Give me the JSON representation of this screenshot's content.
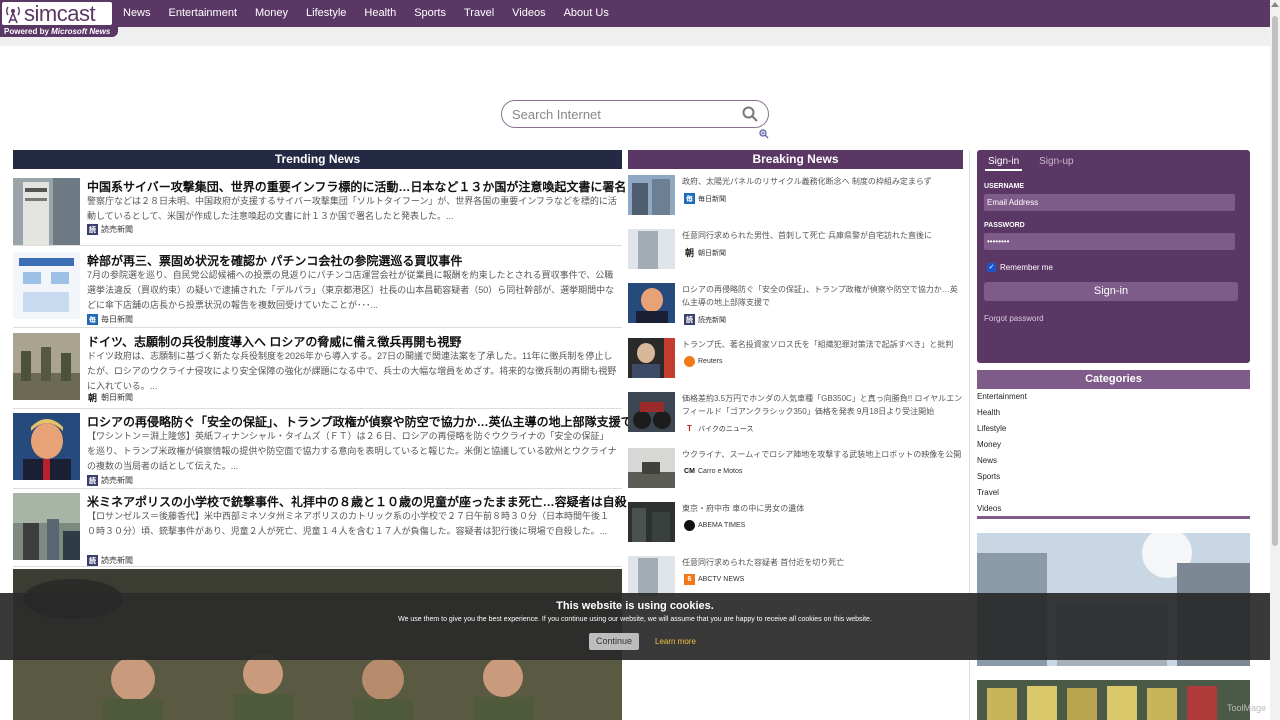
{
  "brand": {
    "name": "simcast",
    "powered_prefix": "Powered by",
    "powered_brand": "Microsoft News",
    "color": "#5b3766"
  },
  "nav": {
    "items": [
      "News",
      "Entertainment",
      "Money",
      "Lifestyle",
      "Health",
      "Sports",
      "Travel",
      "Videos",
      "About Us"
    ]
  },
  "search": {
    "placeholder": "Search Internet",
    "icon": "magnifier-icon"
  },
  "trending": {
    "heading": "Trending News",
    "items": [
      {
        "title": "中国系サイバー攻撃集団、世界の重要インフラ標的に活動…日本など１３か国が注意喚起文書に署名",
        "desc": "警察庁などは２８日未明、中国政府が支援するサイバー攻撃集団「ソルトタイフーン」が、世界各国の重要インフラなどを標的に活動しているとして、米国が作成した注意喚起の文書に計１３か国で署名したと発表した。...",
        "source": "読売新聞"
      },
      {
        "title": "幹部が再三、票固め状況を確認か パチンコ会社の参院選巡る買収事件",
        "desc": "7月の参院選を巡り、自民党公認候補への投票の見返りにパチンコ店運営会社が従業員に報酬を約束したとされる買収事件で、公職選挙法違反（買収約束）の疑いで逮捕された「デルパラ」（東京都港区）社長の山本昌範容疑者（50）ら同社幹部が、選挙期間中などに傘下店舗の店長から投票状況の報告を複数回受けていたことが･･･...",
        "source": "毎日新聞"
      },
      {
        "title": "ドイツ、志願制の兵役制度導入へ ロシアの脅威に備え徴兵再開も視野",
        "desc": "ドイツ政府は、志願制に基づく新たな兵役制度を2026年から導入する。27日の閣議で関連法案を了承した。11年に徴兵制を停止したが、ロシアのウクライナ侵攻により安全保障の強化が課題になる中で、兵士の大幅な増員をめざす。将来的な徴兵制の再開も視野に入れている。...",
        "source": "朝日新聞"
      },
      {
        "title": "ロシアの再侵略防ぐ「安全の保証」、トランプ政権が偵察や防空で協力か…英仏主導の地上部隊支援で",
        "desc": "【ワシントン＝淵上隆悠】英紙フィナンシャル・タイムズ（ＦＴ）は２６日、ロシアの再侵略を防ぐウクライナの「安全の保証」を巡り、トランプ米政権が偵察情報の提供や防空面で協力する意向を表明していると報じた。米側と協議している欧州とウクライナの複数の当局者の話として伝えた。...",
        "source": "読売新聞"
      },
      {
        "title": "米ミネアポリスの小学校で銃撃事件、礼拝中の８歳と１０歳の児童が座ったまま死亡…容疑者は自殺",
        "desc": "【ロサンゼルス＝後藤香代】米中西部ミネソタ州ミネアポリスのカトリック系の小学校で２７日午前８時３０分（日本時間午後１０時３０分）頃、銃撃事件があり、児童２人が死亡、児童１４人を含む１７人が負傷した。容疑者は犯行後に現場で自殺した。...",
        "source": "読売新聞"
      }
    ]
  },
  "breaking": {
    "heading": "Breaking News",
    "items": [
      {
        "title": "政府、太陽光パネルのリサイクル義務化断念へ 制度の枠組み定まらず",
        "source": "毎日新聞"
      },
      {
        "title": "任意同行求められた男性、首刺して死亡 兵庫県警が自宅訪れた直後に",
        "source": "朝日新聞"
      },
      {
        "title": "ロシアの再侵略防ぐ「安全の保証」、トランプ政権が偵察や防空で協力か…英仏主導の地上部隊支援で",
        "source": "読売新聞"
      },
      {
        "title": "トランプ氏、著名投資家ソロス氏を「組織犯罪対策法で起訴すべき」と批判",
        "source": "Reuters"
      },
      {
        "title": "価格差約3.5万円でホンダの人気車種「GB350C」と真っ向勝負!! ロイヤルエンフィールド「ゴアンクラシック350」価格を発表 9月18日より受注開始",
        "source": "バイクのニュース"
      },
      {
        "title": "ウクライナ、スームィでロシア陣地を攻撃する武装地上ロボットの映像を公開",
        "source": "Carro e Motos"
      },
      {
        "title": "東京・府中市 車の中に男女の遺体",
        "source": "ABEMA TIMES"
      },
      {
        "title": "任意同行求められた容疑者 首付近を切り死亡",
        "source": "ABCTV NEWS"
      }
    ]
  },
  "signin": {
    "tab_signin": "Sign-in",
    "tab_signup": "Sign-up",
    "username_label": "USERNAME",
    "username_value": "Email Address",
    "password_label": "PASSWORD",
    "password_value": "••••••••",
    "remember_label": "Remember me",
    "remember_checked": true,
    "button": "Sign-in",
    "forgot": "Forgot password"
  },
  "categories": {
    "heading": "Categories",
    "items": [
      "Entertainment",
      "Health",
      "Lifestyle",
      "Money",
      "News",
      "Sports",
      "Travel",
      "Videos"
    ]
  },
  "cookie": {
    "title": "This website is using cookies.",
    "text": "We use them to give you the best experience. If you continue using our website, we will assume that you are happy to receive all cookies on this website.",
    "button": "Continue",
    "learn": "Learn more"
  },
  "watermark": "ToolMage",
  "colors": {
    "accent": "#5b3766",
    "trending_head": "#252a44",
    "category_head": "#7e5b88"
  }
}
